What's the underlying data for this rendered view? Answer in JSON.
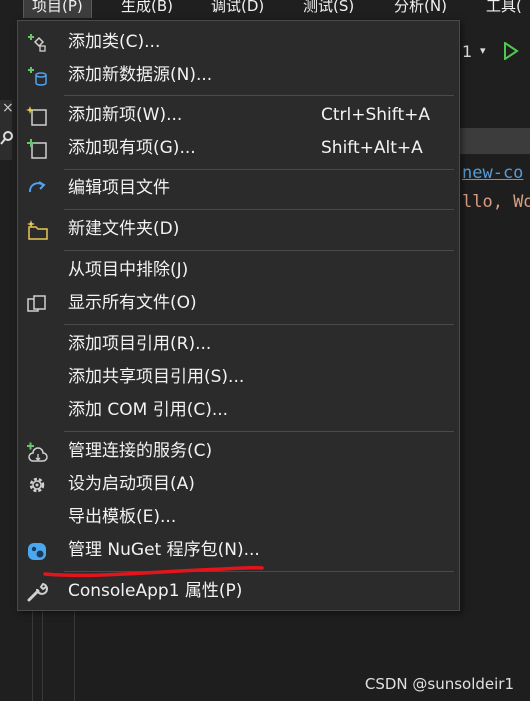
{
  "menubar": {
    "items": [
      {
        "label": "项目(P)",
        "active": true
      },
      {
        "label": "生成(B)"
      },
      {
        "label": "调试(D)"
      },
      {
        "label": "测试(S)"
      },
      {
        "label": "分析(N)"
      },
      {
        "label": "工具("
      }
    ]
  },
  "toolbar": {
    "config_fragment": "1",
    "caret": "▾"
  },
  "editor": {
    "line1": "new-co",
    "line2": "llo, Wo"
  },
  "sidebar": {
    "close_glyph": "×"
  },
  "menu": {
    "items": [
      {
        "label": "添加类(C)...",
        "shortcut": "",
        "icon": "add-class-icon"
      },
      {
        "label": "添加新数据源(N)...",
        "shortcut": "",
        "icon": "add-datasource-icon"
      },
      {
        "label": "添加新项(W)...",
        "shortcut": "Ctrl+Shift+A",
        "icon": "add-new-item-icon"
      },
      {
        "label": "添加现有项(G)...",
        "shortcut": "Shift+Alt+A",
        "icon": "add-existing-item-icon"
      },
      {
        "label": "编辑项目文件",
        "shortcut": "",
        "icon": "edit-project-file-icon"
      },
      {
        "label": "新建文件夹(D)",
        "shortcut": "",
        "icon": "new-folder-icon"
      },
      {
        "label": "从项目中排除(J)",
        "shortcut": "",
        "icon": ""
      },
      {
        "label": "显示所有文件(O)",
        "shortcut": "",
        "icon": "show-all-files-icon"
      },
      {
        "label": "添加项目引用(R)...",
        "shortcut": "",
        "icon": ""
      },
      {
        "label": "添加共享项目引用(S)...",
        "shortcut": "",
        "icon": ""
      },
      {
        "label": "添加 COM 引用(C)...",
        "shortcut": "",
        "icon": ""
      },
      {
        "label": "管理连接的服务(C)",
        "shortcut": "",
        "icon": "connected-services-icon"
      },
      {
        "label": "设为启动项目(A)",
        "shortcut": "",
        "icon": "gear-icon"
      },
      {
        "label": "导出模板(E)...",
        "shortcut": "",
        "icon": ""
      },
      {
        "label": "管理 NuGet 程序包(N)...",
        "shortcut": "",
        "icon": "nuget-icon"
      },
      {
        "label": "ConsoleApp1 属性(P)",
        "shortcut": "",
        "icon": "wrench-icon"
      }
    ]
  },
  "watermark": "CSDN @sunsoldeir1",
  "colors": {
    "menu_bg": "#2b2b2b",
    "accent_blue": "#3794ff",
    "annotation_red": "#e3141c"
  }
}
